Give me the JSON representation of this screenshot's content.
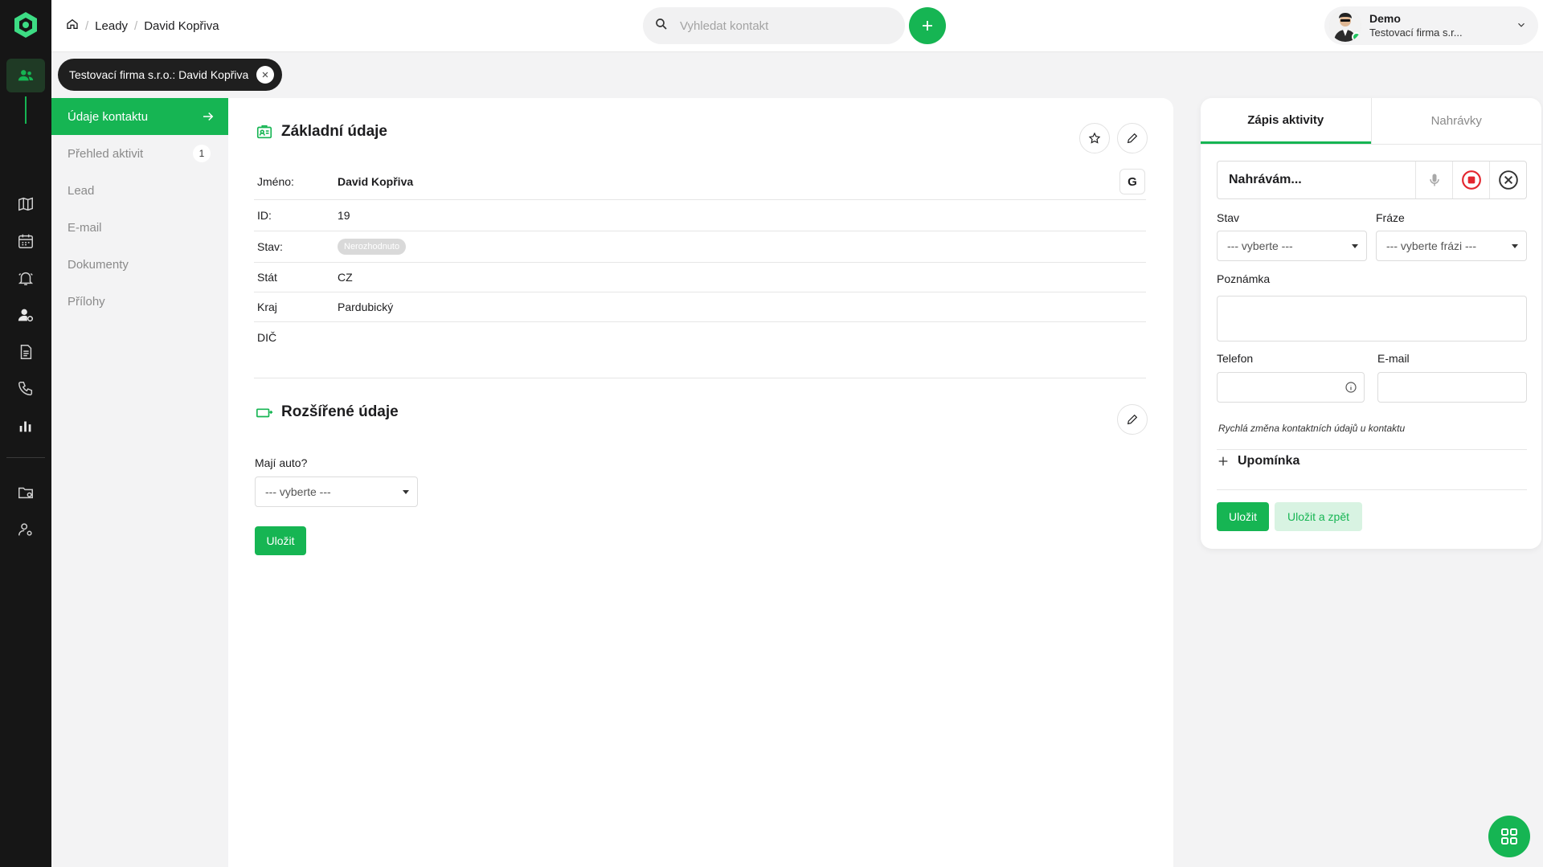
{
  "breadcrumb": {
    "items": [
      "Leady",
      "David Kopřiva"
    ]
  },
  "search": {
    "placeholder": "Vyhledat kontakt"
  },
  "user": {
    "name": "Demo",
    "company": "Testovací firma s.r..."
  },
  "tab": {
    "label": "Testovací firma s.r.o.: David Kopřiva"
  },
  "section_nav": {
    "items": [
      {
        "label": "Údaje kontaktu"
      },
      {
        "label": "Přehled aktivit",
        "badge": "1"
      },
      {
        "label": "Lead"
      },
      {
        "label": "E-mail"
      },
      {
        "label": "Dokumenty"
      },
      {
        "label": "Přílohy"
      }
    ]
  },
  "basic": {
    "title": "Základní údaje",
    "google_label": "G",
    "rows": [
      {
        "label": "Jméno:",
        "value": "David Kopřiva"
      },
      {
        "label": "ID:",
        "value": "19"
      },
      {
        "label": "Stav:",
        "value": "Nerozhodnuto"
      },
      {
        "label": "Stát",
        "value": "CZ"
      },
      {
        "label": "Kraj",
        "value": "Pardubický"
      },
      {
        "label": "DIČ",
        "value": ""
      }
    ]
  },
  "extended": {
    "title": "Rozšířené údaje",
    "field_label": "Mají auto?",
    "select_value": "--- vyberte ---",
    "save_label": "Uložit"
  },
  "activity": {
    "tabs": [
      "Zápis aktivity",
      "Nahrávky"
    ],
    "recording_text": "Nahrávám...",
    "status_label": "Stav",
    "status_value": "--- vyberte ---",
    "phrase_label": "Fráze",
    "phrase_value": "--- vyberte frázi ---",
    "note_label": "Poznámka",
    "phone_label": "Telefon",
    "email_label": "E-mail",
    "hint": "Rychlá změna kontaktních údajů u kontaktu",
    "reminder_label": "Upomínka",
    "save_label": "Uložit",
    "save_back_label": "Uložit a zpět"
  },
  "colors": {
    "accent": "#16b553",
    "rail": "#161616",
    "record": "#e3262f"
  }
}
